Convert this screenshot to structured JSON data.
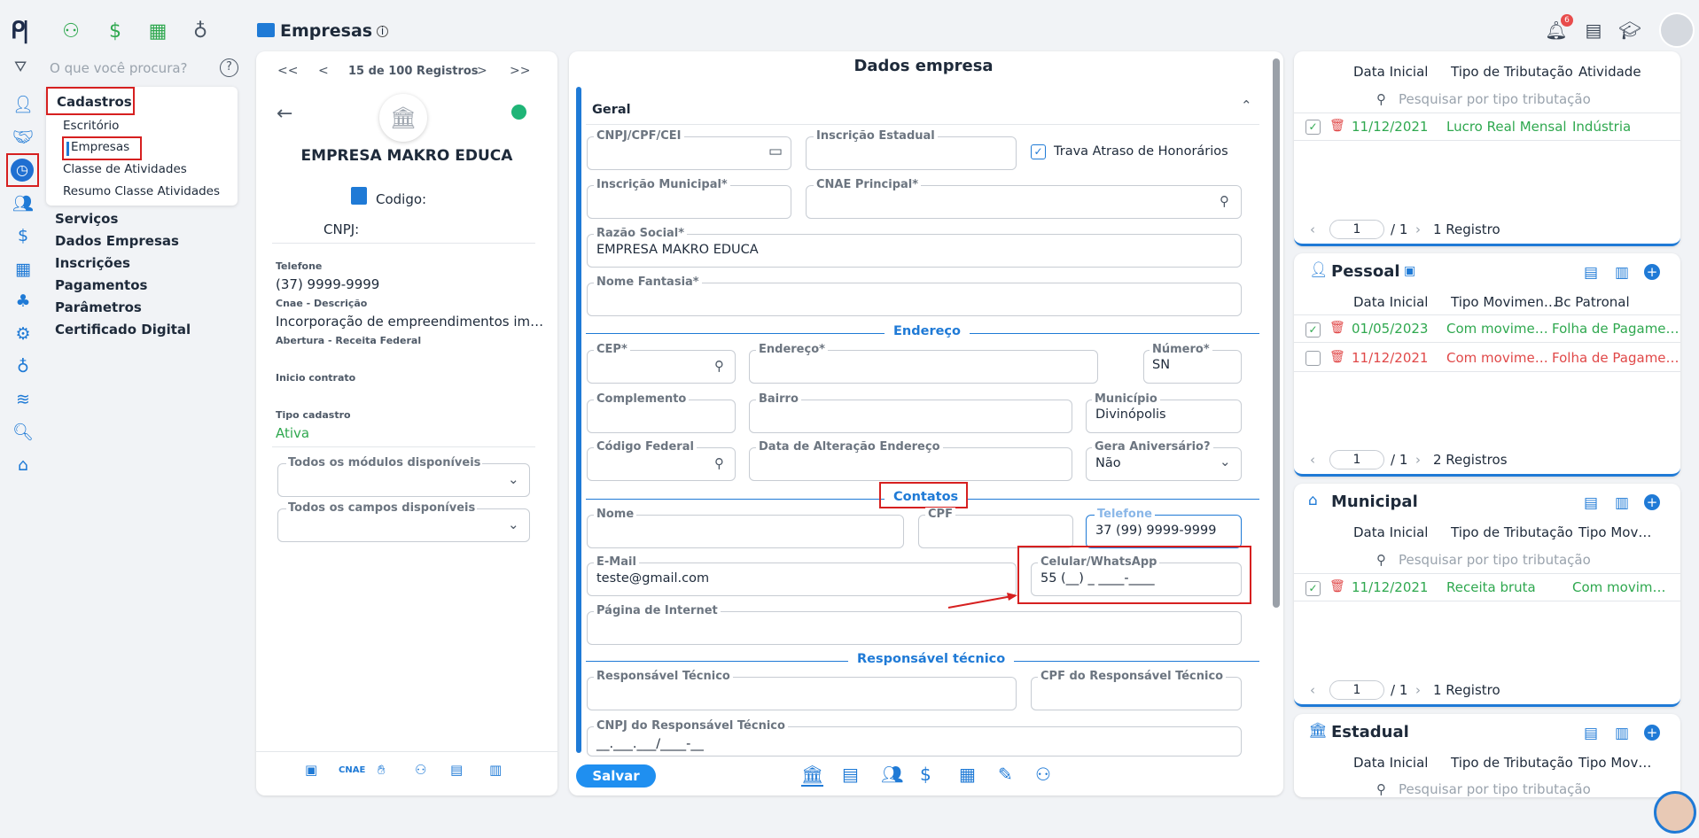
{
  "header": {
    "title": "Empresas",
    "notification_count": "6"
  },
  "search": {
    "placeholder": "O que você procura?"
  },
  "menu": {
    "head": "Cadastros",
    "sub_items": [
      "Escritório",
      "Empresas",
      "Classe de Atividades",
      "Resumo Classe Atividades"
    ],
    "main_items": [
      "Serviços",
      "Dados Empresas",
      "Inscrições",
      "Pagamentos",
      "Parâmetros",
      "Certificado Digital"
    ]
  },
  "company_panel": {
    "pager_text": "15 de 100 Registros",
    "first": "<<",
    "prev": "<",
    "next": ">",
    "last": ">>",
    "company_name": "EMPRESA MAKRO EDUCA",
    "codigo_label": "Codigo:",
    "cnpj_label": "CNPJ:",
    "telefone_label": "Telefone",
    "telefone_value": "(37) 9999-9999",
    "cnae_label": "Cnae - Descrição",
    "cnae_value": "Incorporação de empreendimentos im…",
    "abertura_label": "Abertura - Receita Federal",
    "inicio_label": "Inicio contrato",
    "tipo_label": "Tipo cadastro",
    "tipo_value": "Ativa",
    "modules_label": "Todos os módulos disponíveis",
    "fields_label": "Todos os campos disponíveis",
    "footer_cnae": "CNAE"
  },
  "form": {
    "title": "Dados empresa",
    "section_geral": "Geral",
    "cnpj_label": "CNPJ/CPF/CEI",
    "ie_label": "Inscrição Estadual",
    "trava_label": "Trava Atraso de Honorários",
    "im_label": "Inscrição Municipal*",
    "cnae_label": "CNAE Principal*",
    "razao_label": "Razão Social*",
    "razao_value": "EMPRESA MAKRO EDUCA",
    "fantasia_label": "Nome Fantasia*",
    "section_endereco": "Endereço",
    "cep_label": "CEP*",
    "endereco_label": "Endereço*",
    "numero_label": "Número*",
    "numero_value": "SN",
    "complemento_label": "Complemento",
    "bairro_label": "Bairro",
    "municipio_label": "Município",
    "municipio_value": "Divinópolis",
    "codfed_label": "Código Federal",
    "dataalt_label": "Data de Alteração Endereço",
    "aniv_label": "Gera Aniversário?",
    "aniv_value": "Não",
    "section_contatos": "Contatos",
    "nome_label": "Nome",
    "cpf_label": "CPF",
    "telefone_label": "Telefone",
    "telefone_value": "37 (99) 9999-9999",
    "email_label": "E-Mail",
    "email_value": "teste@gmail.com",
    "celular_label": "Celular/WhatsApp",
    "celular_value": "55 (__) _ ____-____",
    "pagina_label": "Página de Internet",
    "section_resp": "Responsável técnico",
    "resp_label": "Responsável Técnico",
    "cpfresp_label": "CPF do Responsável Técnico",
    "cnpjresp_label": "CNPJ do Responsável Técnico",
    "cnpjresp_value": "__.___.___/____-__",
    "save_label": "Salvar"
  },
  "right": {
    "cards": [
      {
        "title": "",
        "headers": [
          "Data Inicial",
          "Tipo de Tributação",
          "Atividade"
        ],
        "search_placeholder": "Pesquisar por tipo tributação",
        "rows": [
          {
            "checked": true,
            "date": "11/12/2021",
            "col2": "Lucro Real Mensal",
            "col3": "Indústria",
            "color": "green"
          }
        ],
        "page": "1",
        "page_total": "/ 1",
        "count": "1 Registro"
      },
      {
        "title": "Pessoal",
        "headers": [
          "Data Inicial",
          "Tipo Movimen…",
          "Bc Patronal"
        ],
        "rows": [
          {
            "checked": true,
            "date": "01/05/2023",
            "col2": "Com movime…",
            "col3": "Folha de Pagame…",
            "color": "green"
          },
          {
            "checked": false,
            "date": "11/12/2021",
            "col2": "Com movime…",
            "col3": "Folha de Pagame…",
            "color": "red"
          }
        ],
        "page": "1",
        "page_total": "/ 1",
        "count": "2 Registros"
      },
      {
        "title": "Municipal",
        "headers": [
          "Data Inicial",
          "Tipo de Tributação",
          "Tipo Mov…"
        ],
        "search_placeholder": "Pesquisar por tipo tributação",
        "rows": [
          {
            "checked": true,
            "date": "11/12/2021",
            "col2": "Receita bruta",
            "col3": "Com movim…",
            "color": "green"
          }
        ],
        "page": "1",
        "page_total": "/ 1",
        "count": "1 Registro"
      },
      {
        "title": "Estadual",
        "headers": [
          "Data Inicial",
          "Tipo de Tributação",
          "Tipo Mov…"
        ],
        "search_placeholder": "Pesquisar por tipo tributação"
      }
    ]
  },
  "colors": {
    "accent": "#1f7ad6",
    "highlight": "#d62020",
    "success": "#2fa84f",
    "danger": "#e04848"
  }
}
